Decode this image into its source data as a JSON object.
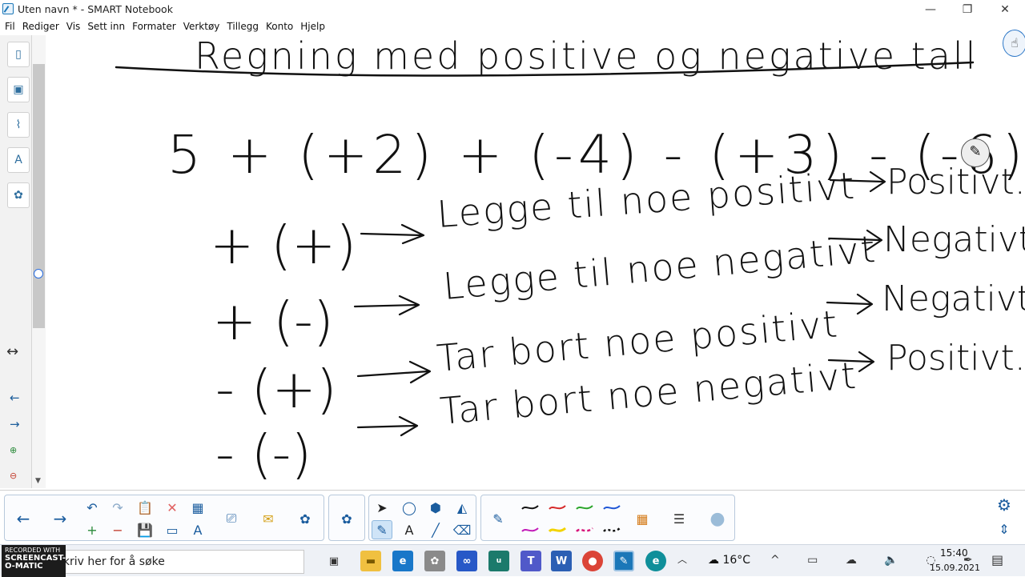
{
  "window": {
    "title": "Uten navn * - SMART Notebook",
    "minimize": "—",
    "maximize": "❐",
    "close": "✕"
  },
  "menu": [
    "Fil",
    "Rediger",
    "Vis",
    "Sett inn",
    "Formater",
    "Verktøy",
    "Tillegg",
    "Konto",
    "Hjelp"
  ],
  "sidebar": {
    "icons": [
      "page-sorter-icon",
      "gallery-icon",
      "attachments-icon",
      "properties-icon",
      "add-ons-icon"
    ],
    "resize_arrows": "↔",
    "nav_back": "←",
    "nav_forward": "→"
  },
  "board": {
    "title": "Regning med positive og negative tall",
    "expression": "5 + (+2) + (-4) - (+3) - (-6)",
    "rules": [
      {
        "sign": "+ (+)",
        "text": "Legge til noe positivt",
        "result": "Positivt."
      },
      {
        "sign": "+ (-)",
        "text": "Legge til noe negativt",
        "result": "Negativt."
      },
      {
        "sign": "- (+)",
        "text": "Tar bort noe positivt",
        "result": "Negativt."
      },
      {
        "sign": "- (-)",
        "text": "Tar bort noe negativt",
        "result": "Positivt."
      }
    ]
  },
  "toolbar": {
    "back": "←",
    "forward": "→",
    "undo": "↶",
    "redo": "↷",
    "paste": "📋",
    "delete": "✕",
    "table": "▦",
    "new_page": "+",
    "delete_page": "−",
    "save": "💾",
    "screen_shade": "▭",
    "text_style": "A",
    "document_camera": "⎚",
    "response": "✉",
    "add_on": "✿",
    "puzzle": "✿",
    "select": "➤",
    "shapes": "◯",
    "fill": "⬢",
    "eraser_highlight": "◭",
    "pens": "✎",
    "text": "A",
    "line": "╱",
    "eraser": "⌫",
    "pen_tool": "✎",
    "grid": "▦",
    "lines_tool": "☰",
    "magic": "●",
    "settings": "⚙",
    "move": "⇕",
    "pen_colors": [
      "#111111",
      "#d62828",
      "#2aa52a",
      "#1f56d6",
      "#c21ab8",
      "#f2d300",
      "#d8147a",
      "#111111"
    ]
  },
  "taskbar": {
    "recorded_with": "RECORDED WITH",
    "recorder": "SCREENCAST-O-MATIC",
    "search_placeholder": "Skriv her for å søke",
    "weather": "16°C",
    "time": "15:40",
    "date": "15.09.2021",
    "tray": "^ ▭ ☁ 🔈 ◌ ✒"
  }
}
